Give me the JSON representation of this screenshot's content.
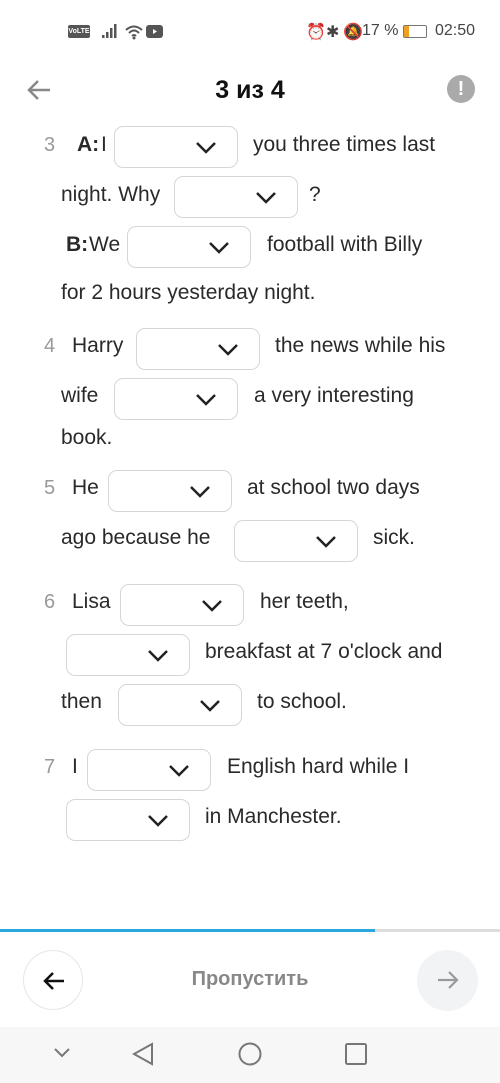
{
  "status_bar": {
    "left_icons": [
      "volte-icon",
      "signal-icon",
      "wifi-icon",
      "youtube-icon"
    ],
    "battery": "17 %",
    "time": "02:50",
    "volte": "VoLTE"
  },
  "header": {
    "title": "3 из 4"
  },
  "questions": [
    {
      "num": "3",
      "a_label": "A:",
      "t1": "I",
      "t2": "you three times last",
      "t3": "night. Why",
      "t4": "?",
      "b_label": "B:",
      "t5": "We",
      "t6": "football with Billy",
      "t7": "for 2 hours yesterday night."
    },
    {
      "num": "4",
      "t1": "Harry",
      "t2": "the news while his",
      "t3": "wife",
      "t4": "a very interesting",
      "t5": "book."
    },
    {
      "num": "5",
      "t1": "He",
      "t2": "at school two days",
      "t3": "ago because he",
      "t4": "sick."
    },
    {
      "num": "6",
      "t1": "Lisa",
      "t2": "her teeth,",
      "t3": "breakfast at 7 o'clock and",
      "t4": "then",
      "t5": "to school."
    },
    {
      "num": "7",
      "t1": "I",
      "t2": "English hard while I",
      "t3": "in Manchester."
    }
  ],
  "progress": {
    "percent": 75,
    "color": "#29a8e0"
  },
  "footer": {
    "skip_label": "Пропустить"
  }
}
